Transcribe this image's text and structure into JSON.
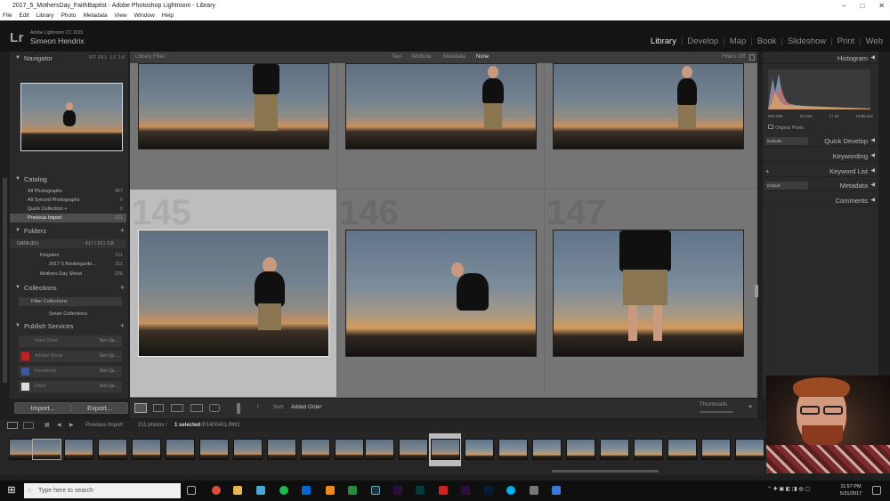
{
  "window": {
    "title": "2017_5_MothersDay_FaithBaptist - Adobe Photoshop Lightroom - Library"
  },
  "menu": [
    "File",
    "Edit",
    "Library",
    "Photo",
    "Metadata",
    "View",
    "Window",
    "Help"
  ],
  "header": {
    "logo": "Lr",
    "version": "Adobe Lightroom CC 2015",
    "user": "Simeon Hendrix"
  },
  "modules": [
    "Library",
    "Develop",
    "Map",
    "Book",
    "Slideshow",
    "Print",
    "Web"
  ],
  "left": {
    "navigator": {
      "title": "Navigator",
      "zoom": [
        "FIT",
        "FILL",
        "1:1",
        "1:8"
      ]
    },
    "catalog": {
      "title": "Catalog",
      "items": [
        {
          "label": "All Photographs",
          "count": "457"
        },
        {
          "label": "All Synced Photographs",
          "count": "0"
        },
        {
          "label": "Quick Collection +",
          "count": "0"
        },
        {
          "label": "Previous Import",
          "count": "211"
        }
      ]
    },
    "folders": {
      "title": "Folders",
      "drive": "DATA (D:)",
      "drive_space": "417 / 931 GB",
      "items": [
        {
          "label": "Kingston",
          "count": "211"
        },
        {
          "label": "2017 5 Kindergarde...",
          "count": "211"
        },
        {
          "label": "Mothers Day Shoot",
          "count": "226"
        }
      ]
    },
    "collections": {
      "title": "Collections",
      "filter": "Filter Collections",
      "smart": "Smart Collections"
    },
    "publish": {
      "title": "Publish Services",
      "items": [
        {
          "label": "Hard Drive",
          "action": "Set Up..."
        },
        {
          "label": "Adobe Stock",
          "action": "Set Up..."
        },
        {
          "label": "Facebook",
          "action": "Set Up..."
        },
        {
          "label": "Flickr",
          "action": "Set Up..."
        }
      ]
    },
    "import_label": "Import...",
    "export_label": "Export..."
  },
  "filterbar": {
    "label": "Library Filter :",
    "options": [
      "Text",
      "Attribute",
      "Metadata",
      "None"
    ],
    "status": "Filters Off"
  },
  "grid": {
    "numbers": [
      "145",
      "146",
      "147"
    ]
  },
  "toolbar": {
    "sort_label": "Sort:",
    "sort_value": "Added Order",
    "thumbs_label": "Thumbnails"
  },
  "right": {
    "histogram": {
      "title": "Histogram",
      "iso": "ISO 200",
      "focal": "21 mm",
      "aperture": "f / 10",
      "shutter": "1/200 sec",
      "original": "Original Photo"
    },
    "quick_preset": "Defaults",
    "panels": [
      "Quick Develop",
      "Keywording",
      "Keyword List",
      "Metadata",
      "Comments"
    ],
    "metadata_preset": "Default"
  },
  "filmstrip": {
    "source": "Previous Import",
    "count": "211 photos /",
    "selected": "1 selected",
    "file": "/P1400401.RW2"
  },
  "taskbar": {
    "search": "Type here to search",
    "time": "11:57 PM",
    "date": "5/31/2017"
  }
}
